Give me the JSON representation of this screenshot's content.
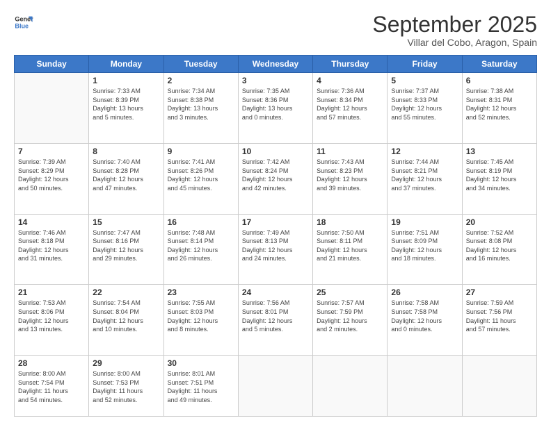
{
  "logo": {
    "line1": "General",
    "line2": "Blue"
  },
  "title": "September 2025",
  "subtitle": "Villar del Cobo, Aragon, Spain",
  "weekdays": [
    "Sunday",
    "Monday",
    "Tuesday",
    "Wednesday",
    "Thursday",
    "Friday",
    "Saturday"
  ],
  "weeks": [
    [
      {
        "day": "",
        "info": ""
      },
      {
        "day": "1",
        "info": "Sunrise: 7:33 AM\nSunset: 8:39 PM\nDaylight: 13 hours\nand 5 minutes."
      },
      {
        "day": "2",
        "info": "Sunrise: 7:34 AM\nSunset: 8:38 PM\nDaylight: 13 hours\nand 3 minutes."
      },
      {
        "day": "3",
        "info": "Sunrise: 7:35 AM\nSunset: 8:36 PM\nDaylight: 13 hours\nand 0 minutes."
      },
      {
        "day": "4",
        "info": "Sunrise: 7:36 AM\nSunset: 8:34 PM\nDaylight: 12 hours\nand 57 minutes."
      },
      {
        "day": "5",
        "info": "Sunrise: 7:37 AM\nSunset: 8:33 PM\nDaylight: 12 hours\nand 55 minutes."
      },
      {
        "day": "6",
        "info": "Sunrise: 7:38 AM\nSunset: 8:31 PM\nDaylight: 12 hours\nand 52 minutes."
      }
    ],
    [
      {
        "day": "7",
        "info": "Sunrise: 7:39 AM\nSunset: 8:29 PM\nDaylight: 12 hours\nand 50 minutes."
      },
      {
        "day": "8",
        "info": "Sunrise: 7:40 AM\nSunset: 8:28 PM\nDaylight: 12 hours\nand 47 minutes."
      },
      {
        "day": "9",
        "info": "Sunrise: 7:41 AM\nSunset: 8:26 PM\nDaylight: 12 hours\nand 45 minutes."
      },
      {
        "day": "10",
        "info": "Sunrise: 7:42 AM\nSunset: 8:24 PM\nDaylight: 12 hours\nand 42 minutes."
      },
      {
        "day": "11",
        "info": "Sunrise: 7:43 AM\nSunset: 8:23 PM\nDaylight: 12 hours\nand 39 minutes."
      },
      {
        "day": "12",
        "info": "Sunrise: 7:44 AM\nSunset: 8:21 PM\nDaylight: 12 hours\nand 37 minutes."
      },
      {
        "day": "13",
        "info": "Sunrise: 7:45 AM\nSunset: 8:19 PM\nDaylight: 12 hours\nand 34 minutes."
      }
    ],
    [
      {
        "day": "14",
        "info": "Sunrise: 7:46 AM\nSunset: 8:18 PM\nDaylight: 12 hours\nand 31 minutes."
      },
      {
        "day": "15",
        "info": "Sunrise: 7:47 AM\nSunset: 8:16 PM\nDaylight: 12 hours\nand 29 minutes."
      },
      {
        "day": "16",
        "info": "Sunrise: 7:48 AM\nSunset: 8:14 PM\nDaylight: 12 hours\nand 26 minutes."
      },
      {
        "day": "17",
        "info": "Sunrise: 7:49 AM\nSunset: 8:13 PM\nDaylight: 12 hours\nand 24 minutes."
      },
      {
        "day": "18",
        "info": "Sunrise: 7:50 AM\nSunset: 8:11 PM\nDaylight: 12 hours\nand 21 minutes."
      },
      {
        "day": "19",
        "info": "Sunrise: 7:51 AM\nSunset: 8:09 PM\nDaylight: 12 hours\nand 18 minutes."
      },
      {
        "day": "20",
        "info": "Sunrise: 7:52 AM\nSunset: 8:08 PM\nDaylight: 12 hours\nand 16 minutes."
      }
    ],
    [
      {
        "day": "21",
        "info": "Sunrise: 7:53 AM\nSunset: 8:06 PM\nDaylight: 12 hours\nand 13 minutes."
      },
      {
        "day": "22",
        "info": "Sunrise: 7:54 AM\nSunset: 8:04 PM\nDaylight: 12 hours\nand 10 minutes."
      },
      {
        "day": "23",
        "info": "Sunrise: 7:55 AM\nSunset: 8:03 PM\nDaylight: 12 hours\nand 8 minutes."
      },
      {
        "day": "24",
        "info": "Sunrise: 7:56 AM\nSunset: 8:01 PM\nDaylight: 12 hours\nand 5 minutes."
      },
      {
        "day": "25",
        "info": "Sunrise: 7:57 AM\nSunset: 7:59 PM\nDaylight: 12 hours\nand 2 minutes."
      },
      {
        "day": "26",
        "info": "Sunrise: 7:58 AM\nSunset: 7:58 PM\nDaylight: 12 hours\nand 0 minutes."
      },
      {
        "day": "27",
        "info": "Sunrise: 7:59 AM\nSunset: 7:56 PM\nDaylight: 11 hours\nand 57 minutes."
      }
    ],
    [
      {
        "day": "28",
        "info": "Sunrise: 8:00 AM\nSunset: 7:54 PM\nDaylight: 11 hours\nand 54 minutes."
      },
      {
        "day": "29",
        "info": "Sunrise: 8:00 AM\nSunset: 7:53 PM\nDaylight: 11 hours\nand 52 minutes."
      },
      {
        "day": "30",
        "info": "Sunrise: 8:01 AM\nSunset: 7:51 PM\nDaylight: 11 hours\nand 49 minutes."
      },
      {
        "day": "",
        "info": ""
      },
      {
        "day": "",
        "info": ""
      },
      {
        "day": "",
        "info": ""
      },
      {
        "day": "",
        "info": ""
      }
    ]
  ]
}
